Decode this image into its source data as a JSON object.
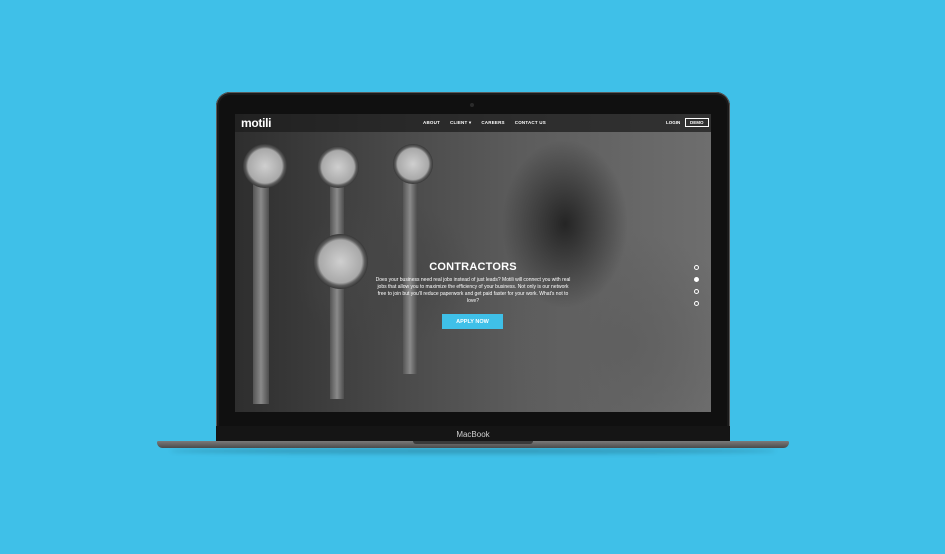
{
  "device": {
    "brand_label": "MacBook"
  },
  "site": {
    "logo": "motili",
    "nav": {
      "links": [
        "ABOUT",
        "CLIENT ▾",
        "CAREERS",
        "CONTACT US"
      ],
      "login": "LOGIN",
      "demo": "DEMO"
    },
    "hero": {
      "title": "CONTRACTORS",
      "text": "Does your business need real jobs instead of just leads? Motili will connect you with real jobs that allow you to maximize the efficiency of your business. Not only is our network free to join but you'll reduce paperwork and get paid faster for your work. What's not to love?",
      "cta": "APPLY NOW"
    },
    "slider": {
      "count": 4,
      "active_index": 1
    }
  },
  "colors": {
    "accent": "#3fc0e8",
    "background": "#3fc0e8"
  }
}
